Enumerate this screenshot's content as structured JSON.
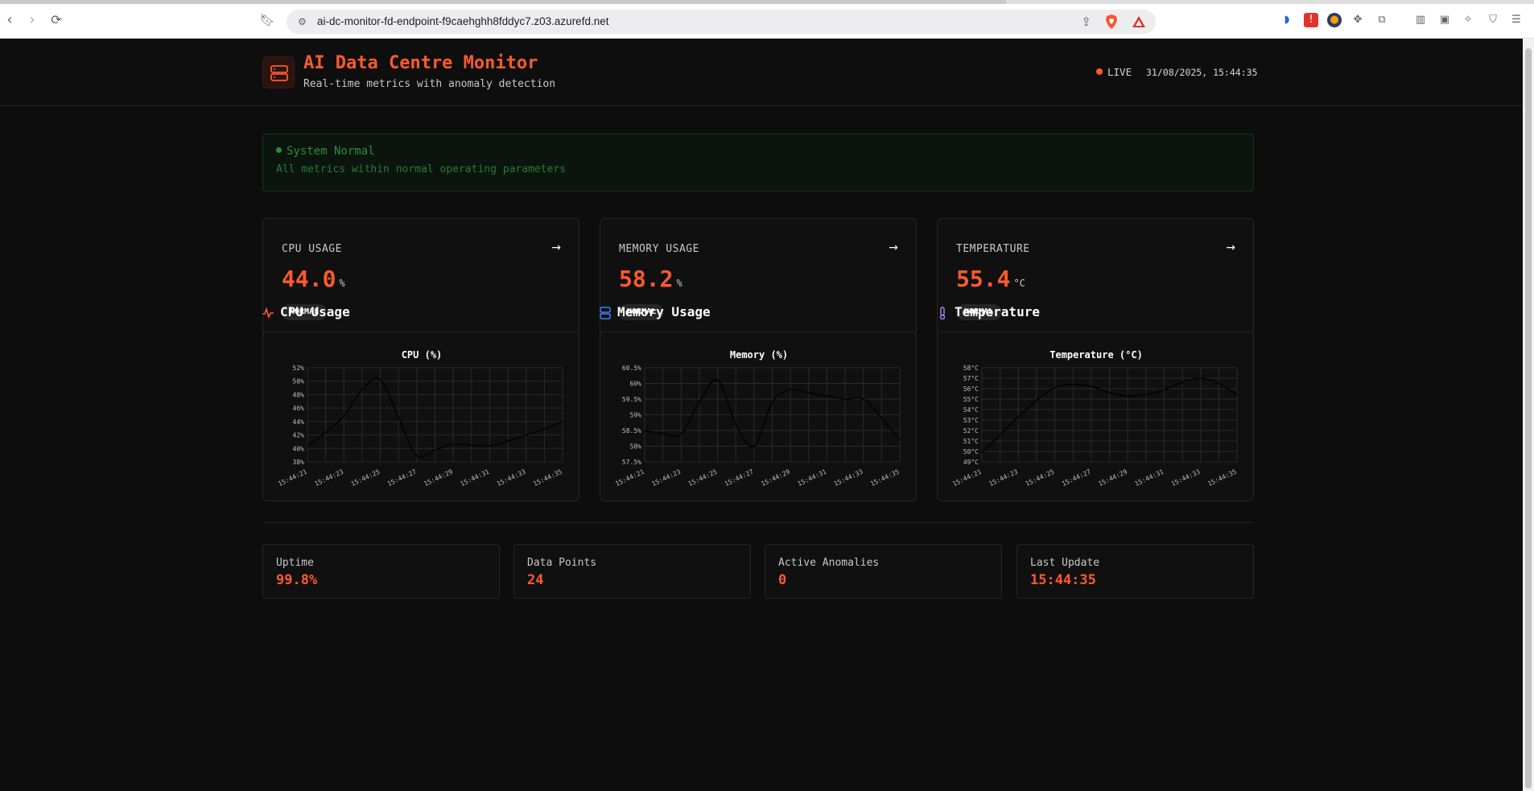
{
  "browser": {
    "url": "ai-dc-monitor-fd-endpoint-f9caehghh8fddyc7.z03.azurefd.net"
  },
  "header": {
    "title": "AI Data Centre Monitor",
    "subtitle": "Real-time metrics with anomaly detection",
    "live_label": "LIVE",
    "datetime": "31/08/2025, 15:44:35"
  },
  "status": {
    "title": "System Normal",
    "description": "All metrics within normal operating parameters"
  },
  "metrics": [
    {
      "label": "CPU USAGE",
      "value": "44.0",
      "unit": "%",
      "status": "NORMAL"
    },
    {
      "label": "MEMORY USAGE",
      "value": "58.2",
      "unit": "%",
      "status": "NORMAL"
    },
    {
      "label": "TEMPERATURE",
      "value": "55.4",
      "unit": "°C",
      "status": "NORMAL"
    }
  ],
  "sections": {
    "cpu": "CPU Usage",
    "memory": "Memory Usage",
    "temperature": "Temperature"
  },
  "colors": {
    "accent": "#ff5a2e",
    "normal": "#2f8c3e",
    "memory_icon": "#3b82f6",
    "temperature_icon": "#a78bfa"
  },
  "chart_data": [
    {
      "type": "line",
      "title": "CPU (%)",
      "x": [
        "15:44:21",
        "15:44:22",
        "15:44:23",
        "15:44:24",
        "15:44:25",
        "15:44:26",
        "15:44:27",
        "15:44:28",
        "15:44:29",
        "15:44:30",
        "15:44:31",
        "15:44:32",
        "15:44:33",
        "15:44:34",
        "15:44:35"
      ],
      "x_ticks": [
        "15:44:21",
        "15:44:23",
        "15:44:25",
        "15:44:27",
        "15:44:29",
        "15:44:31",
        "15:44:33",
        "15:44:35"
      ],
      "values": [
        40.3,
        42.4,
        44.8,
        48.8,
        50.2,
        44.6,
        38.9,
        39.8,
        40.6,
        40.5,
        40.4,
        41.1,
        42.0,
        42.9,
        44.0
      ],
      "ylim": [
        38,
        52
      ],
      "y_ticks": [
        "38%",
        "40%",
        "42%",
        "44%",
        "46%",
        "48%",
        "50%",
        "52%"
      ],
      "grid": true
    },
    {
      "type": "line",
      "title": "Memory (%)",
      "x": [
        "15:44:21",
        "15:44:22",
        "15:44:23",
        "15:44:24",
        "15:44:25",
        "15:44:26",
        "15:44:27",
        "15:44:28",
        "15:44:29",
        "15:44:30",
        "15:44:31",
        "15:44:32",
        "15:44:33",
        "15:44:34",
        "15:44:35"
      ],
      "x_ticks": [
        "15:44:21",
        "15:44:23",
        "15:44:25",
        "15:44:27",
        "15:44:29",
        "15:44:31",
        "15:44:33",
        "15:44:35"
      ],
      "values": [
        58.5,
        58.4,
        58.4,
        59.4,
        60.1,
        58.7,
        58.0,
        59.4,
        59.8,
        59.7,
        59.6,
        59.5,
        59.5,
        58.9,
        58.2
      ],
      "ylim": [
        57.5,
        60.5
      ],
      "y_ticks": [
        "57.5%",
        "58%",
        "58.5%",
        "59%",
        "59.5%",
        "60%",
        "60.5%"
      ],
      "grid": true
    },
    {
      "type": "line",
      "title": "Temperature (°C)",
      "x": [
        "15:44:21",
        "15:44:22",
        "15:44:23",
        "15:44:24",
        "15:44:25",
        "15:44:26",
        "15:44:27",
        "15:44:28",
        "15:44:29",
        "15:44:30",
        "15:44:31",
        "15:44:32",
        "15:44:33",
        "15:44:34",
        "15:44:35"
      ],
      "x_ticks": [
        "15:44:21",
        "15:44:23",
        "15:44:25",
        "15:44:27",
        "15:44:29",
        "15:44:31",
        "15:44:33",
        "15:44:35"
      ],
      "values": [
        49.9,
        51.6,
        53.3,
        54.9,
        56.1,
        56.4,
        56.2,
        55.6,
        55.3,
        55.4,
        55.9,
        56.6,
        57.0,
        56.5,
        55.4
      ],
      "ylim": [
        49,
        58
      ],
      "y_ticks": [
        "49°C",
        "50°C",
        "51°C",
        "52°C",
        "53°C",
        "54°C",
        "55°C",
        "56°C",
        "57°C",
        "58°C"
      ],
      "grid": true
    }
  ],
  "stats": [
    {
      "label": "Uptime",
      "value": "99.8%"
    },
    {
      "label": "Data Points",
      "value": "24"
    },
    {
      "label": "Active Anomalies",
      "value": "0"
    },
    {
      "label": "Last Update",
      "value": "15:44:35"
    }
  ]
}
